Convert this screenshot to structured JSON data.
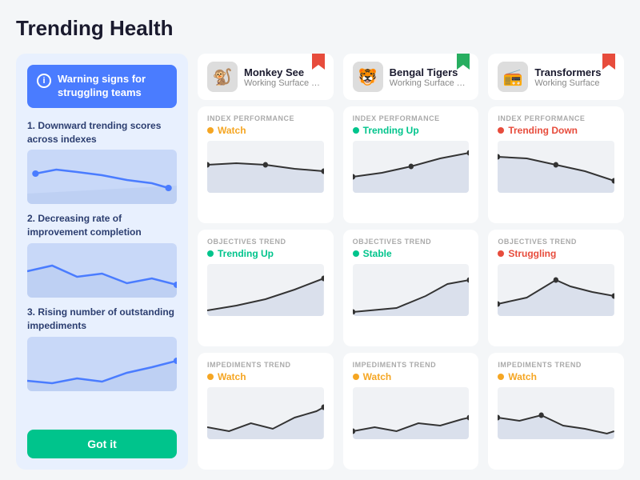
{
  "page": {
    "title": "Trending Health"
  },
  "left_panel": {
    "header": {
      "icon": "i",
      "text": "Warning signs for struggling teams"
    },
    "items": [
      {
        "number": "1.",
        "label": "Downward trending scores across indexes"
      },
      {
        "number": "2.",
        "label": "Decreasing rate of improvement completion"
      },
      {
        "number": "3.",
        "label": "Rising number of outstanding impediments"
      }
    ],
    "button": "Got it"
  },
  "teams": [
    {
      "name": "Monkey See",
      "subtitle": "Working Surface Te...",
      "avatar": "🐒",
      "bookmark_color": "#e74c3c",
      "metrics": [
        {
          "label": "INDEX PERFORMANCE",
          "status": "Watch",
          "status_color": "orange",
          "chart_type": "flat_slight_down"
        },
        {
          "label": "OBJECTIVES TREND",
          "status": "Trending Up",
          "status_color": "green",
          "chart_type": "up"
        },
        {
          "label": "IMPEDIMENTS TREND",
          "status": "Watch",
          "status_color": "orange",
          "chart_type": "zigzag_up"
        }
      ]
    },
    {
      "name": "Bengal Tigers",
      "subtitle": "Working Surface Te...",
      "avatar": "🐯",
      "bookmark_color": "#27ae60",
      "metrics": [
        {
          "label": "INDEX PERFORMANCE",
          "status": "Trending Up",
          "status_color": "green",
          "chart_type": "up_smooth"
        },
        {
          "label": "OBJECTIVES TREND",
          "status": "Stable",
          "status_color": "green",
          "chart_type": "gradual_up"
        },
        {
          "label": "IMPEDIMENTS TREND",
          "status": "Watch",
          "status_color": "orange",
          "chart_type": "zigzag_mild"
        }
      ]
    },
    {
      "name": "Transformers",
      "subtitle": "Working Surface",
      "avatar": "📻",
      "bookmark_color": "#e74c3c",
      "metrics": [
        {
          "label": "INDEX PERFORMANCE",
          "status": "Trending Down",
          "status_color": "red",
          "chart_type": "down_smooth"
        },
        {
          "label": "OBJECTIVES TREND",
          "status": "Struggling",
          "status_color": "red",
          "chart_type": "struggling"
        },
        {
          "label": "IMPEDIMENTS TREND",
          "status": "Watch",
          "status_color": "orange",
          "chart_type": "down_zigzag"
        }
      ]
    }
  ]
}
